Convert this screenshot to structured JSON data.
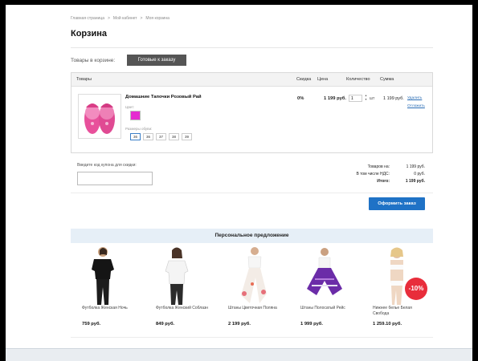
{
  "breadcrumb": [
    "Главная страница",
    "Мой кабинет",
    "Моя корзина"
  ],
  "breadcrumb_sep": ">",
  "page_title": "Корзина",
  "cart_label": "Товары в корзине:",
  "ready_button": "Готовые к заказу",
  "table": {
    "headers": {
      "goods": "Товары",
      "discount": "Скидка",
      "price": "Цена",
      "qty": "Количество",
      "sum": "Сумма"
    },
    "item": {
      "name": "Домашние Тапочки Розовый Рай",
      "color_label": "Цвет:",
      "color_swatch": "#e52bd0",
      "size_label": "Размеры обуви:",
      "sizes": [
        "36",
        "36",
        "37",
        "38",
        "39"
      ],
      "selected_size_index": 0,
      "discount": "0%",
      "price": "1 199 руб.",
      "qty": "1",
      "qty_unit": "шт",
      "sum": "1 199 руб.",
      "delete_link": "Удалить",
      "postpone_link": "Отложить"
    }
  },
  "coupon": {
    "label": "Введите код купона для скидки:",
    "value": ""
  },
  "totals": {
    "goods_label": "Товаров на:",
    "goods_value": "1 199 руб.",
    "vat_label": "В том числе НДС:",
    "vat_value": "0 руб.",
    "total_label": "Итого:",
    "total_value": "1 199 руб."
  },
  "checkout_button": "Оформить заказ",
  "offer": {
    "title": "Персональное предложение",
    "items": [
      {
        "name": "Футболка Женская Ночь",
        "price": "759 руб."
      },
      {
        "name": "Футболка Женский Соблазн",
        "price": "849 руб."
      },
      {
        "name": "Штаны Цветочная Поляна",
        "price": "2 199 руб."
      },
      {
        "name": "Штаны Полосатый Рейс",
        "price": "1 999 руб."
      },
      {
        "name": "Нижнее белье Белая Свобода",
        "price": "1 259.10 руб.",
        "badge": "-10%"
      }
    ]
  }
}
